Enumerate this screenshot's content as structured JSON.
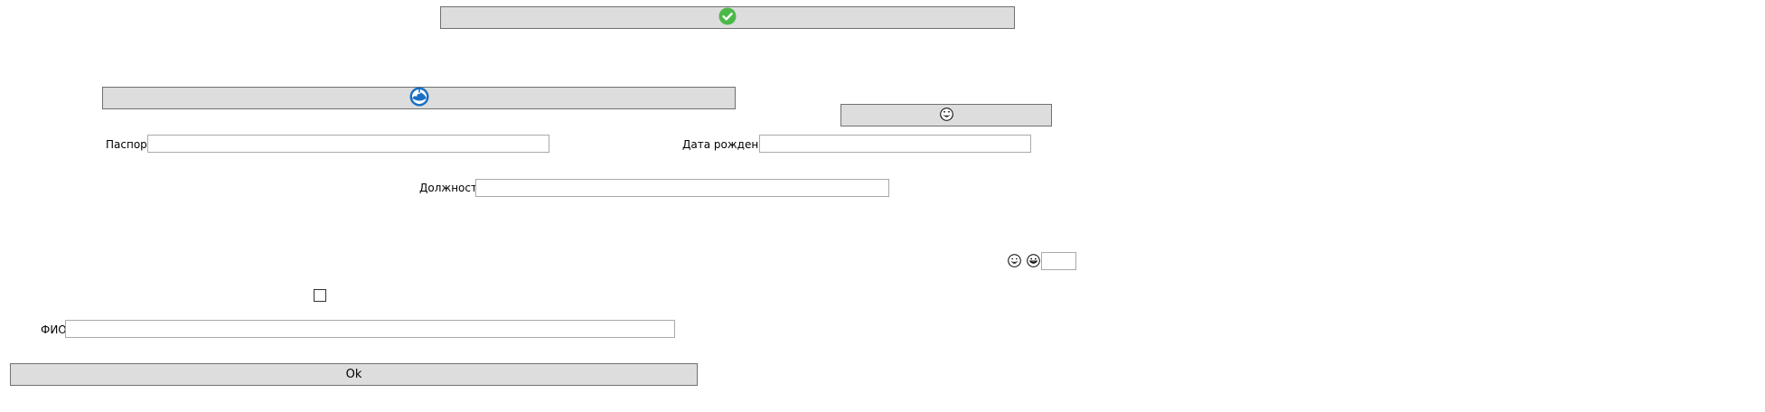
{
  "form": {
    "passport_label": "Паспорт",
    "birthdate_label": "Дата рождения",
    "position_label": "Должность",
    "fullname_label": "ФИО",
    "ok_label": "Ok",
    "passport_value": "",
    "birthdate_value": "",
    "position_value": "",
    "fullname_value": "",
    "small_field_value": "",
    "checkbox_checked": false
  },
  "icons": {
    "top_button": "checkmark-circle-icon",
    "second_button": "blue-globe-icon",
    "right_button": "smiley-icon",
    "row_icon_1": "laughing-face-icon",
    "row_icon_2": "grin-face-icon"
  },
  "colors": {
    "button_bg": "#dddddd",
    "button_border": "#707070",
    "check_green": "#4cb848",
    "globe_blue": "#1a6fc4"
  }
}
